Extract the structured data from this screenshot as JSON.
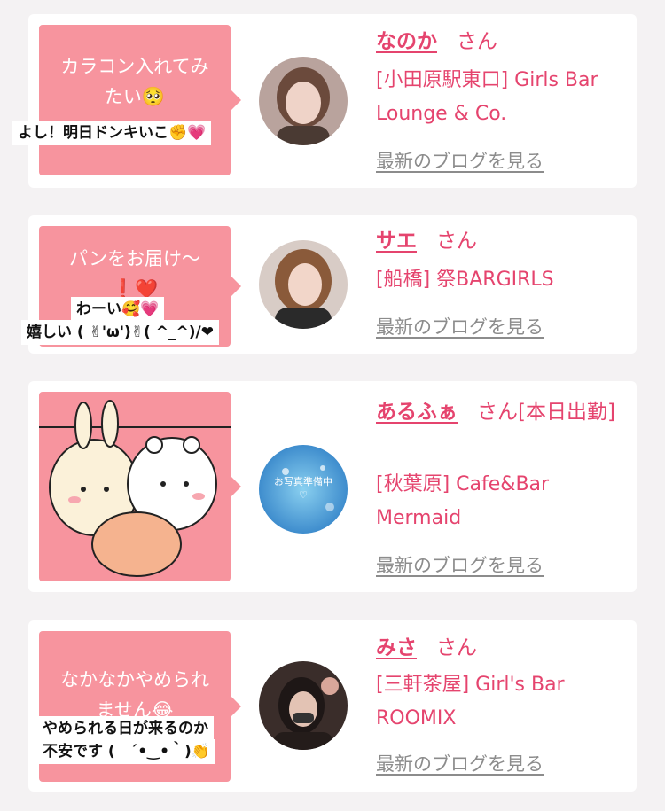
{
  "cards": [
    {
      "bubble_text": "カラコン入れてみたい🥺",
      "stickers": [
        "よし！明日ドンキいこ✊💗"
      ],
      "avatar_icon": "girl-portrait-photo",
      "name": "なのか",
      "honorific": "さん",
      "shop": "[小田原駅東口] Girls Bar Lounge & Co.",
      "blog_link": "最新のブログを見る"
    },
    {
      "bubble_text": "パンをお届け〜❗️❤️",
      "stickers": [
        "わーい🥰💗",
        "嬉しい ( ✌︎'ω')✌︎( ^_^)/❤"
      ],
      "avatar_icon": "girl-portrait-photo",
      "name": "サエ",
      "honorific": "さん",
      "shop": "[船橋] 祭BARGIRLS",
      "blog_link": "最新のブログを見る"
    },
    {
      "bubble_text": "",
      "stickers": [],
      "bubble_image": "cartoon-characters-eating-illustration",
      "avatar_placeholder": "お写真準備中♡",
      "name": "あるふぁ",
      "honorific": "さん[本日出勤]",
      "shop": "[秋葉原] Cafe&Bar Mermaid",
      "blog_link": "最新のブログを見る"
    },
    {
      "bubble_text": "なかなかやめられません😂",
      "stickers": [
        "やめられる日が来るのか",
        "不安です (　´•‿•｀)👏"
      ],
      "avatar_icon": "girl-portrait-photo",
      "name": "みさ",
      "honorific": "さん",
      "shop": "[三軒茶屋] Girl's Bar ROOMIX",
      "blog_link": "最新のブログを見る"
    }
  ],
  "colors": {
    "accent": "#e5446e",
    "bubble": "#f7949e",
    "link_gray": "#8c8c8c"
  }
}
